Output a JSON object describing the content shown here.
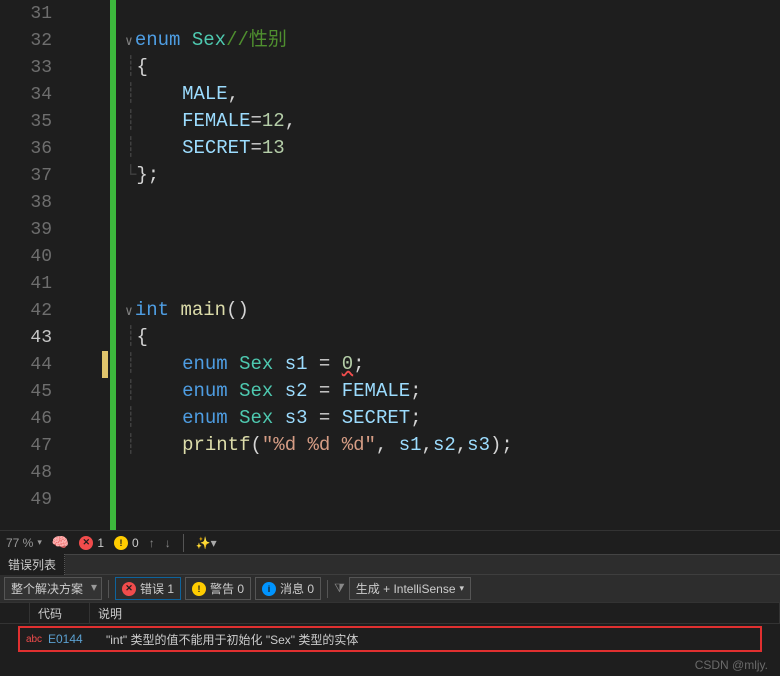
{
  "editor": {
    "lines": [
      {
        "n": 31,
        "html": ""
      },
      {
        "n": 32,
        "html": "<span class='fold'>∨</span><span class='kw'>enum</span> <span class='type'>Sex</span><span class='comment'>//性别</span>"
      },
      {
        "n": 33,
        "html": "<span class='guide'>┊</span><span class='punct'>{</span>"
      },
      {
        "n": 34,
        "html": "<span class='guide'>┊</span>    <span class='ident'>MALE</span>,"
      },
      {
        "n": 35,
        "html": "<span class='guide'>┊</span>    <span class='ident'>FEMALE</span>=<span class='num'>12</span>,"
      },
      {
        "n": 36,
        "html": "<span class='guide'>┊</span>    <span class='ident'>SECRET</span>=<span class='num'>13</span>"
      },
      {
        "n": 37,
        "html": "<span class='guide'>└</span><span class='punct'>};</span>"
      },
      {
        "n": 38,
        "html": ""
      },
      {
        "n": 39,
        "html": ""
      },
      {
        "n": 40,
        "html": ""
      },
      {
        "n": 41,
        "html": ""
      },
      {
        "n": 42,
        "html": "<span class='fold'>∨</span><span class='kw'>int</span> <span class='func'>main</span>()"
      },
      {
        "n": 43,
        "html": "<span class='guide'>┊</span><span class='punct'>{</span>",
        "current": true
      },
      {
        "n": 44,
        "html": "<span class='guide'>┊</span>    <span class='kw'>enum</span> <span class='type'>Sex</span> <span class='ident'>s1</span> = <span class='num squiggle'>0</span>;",
        "yellow": true
      },
      {
        "n": 45,
        "html": "<span class='guide'>┊</span>    <span class='kw'>enum</span> <span class='type'>Sex</span> <span class='ident'>s2</span> = <span class='ident'>FEMALE</span>;"
      },
      {
        "n": 46,
        "html": "<span class='guide'>┊</span>    <span class='kw'>enum</span> <span class='type'>Sex</span> <span class='ident'>s3</span> = <span class='ident'>SECRET</span>;"
      },
      {
        "n": 47,
        "html": "<span class='guide'>┊</span>    <span class='func'>printf</span>(<span class='str'>\"%d %d %d\"</span>, <span class='ident'>s1</span>,<span class='ident'>s2</span>,<span class='ident'>s3</span>);"
      },
      {
        "n": 48,
        "html": ""
      },
      {
        "n": 49,
        "html": ""
      }
    ]
  },
  "status": {
    "zoom": "77 %",
    "errors": "1",
    "warnings": "0"
  },
  "panel": {
    "tab": "错误列表"
  },
  "toolbar": {
    "scope": "整个解决方案",
    "err_label": "错误 1",
    "warn_label": "警告 0",
    "info_label": "消息 0",
    "build": "生成 + IntelliSense"
  },
  "errorlist": {
    "headers": {
      "code": "代码",
      "desc": "说明"
    },
    "rows": [
      {
        "icon": "abc",
        "code": "E0144",
        "desc": "\"int\" 类型的值不能用于初始化 \"Sex\" 类型的实体"
      }
    ]
  },
  "watermark": "CSDN @mljy."
}
